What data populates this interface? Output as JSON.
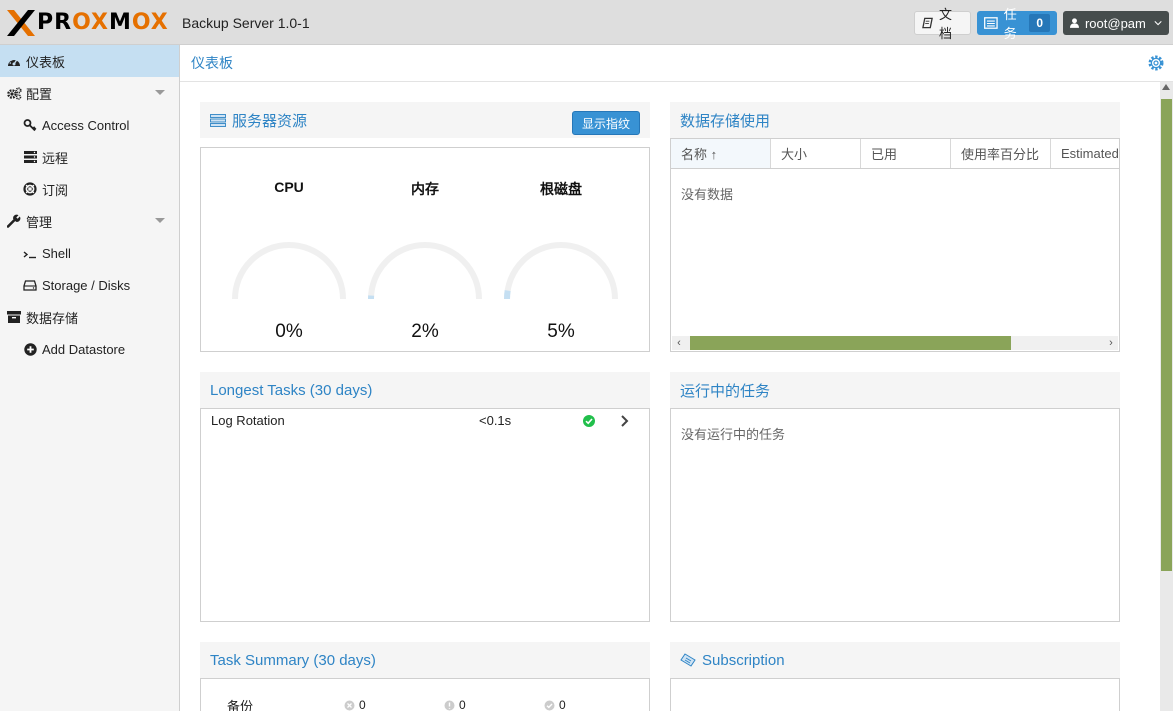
{
  "header": {
    "logo_text_1": "PR",
    "logo_text_2": "OX",
    "logo_text_3": "M",
    "logo_text_4": "OX",
    "product": "Backup Server 1.0-1",
    "docs_label": "文档",
    "tasks_label": "任务",
    "tasks_count": "0",
    "user_label": "root@pam"
  },
  "sidebar": {
    "items": [
      {
        "label": "仪表板",
        "icon": "dashboard-icon",
        "active": true
      },
      {
        "label": "配置",
        "icon": "cogs-icon"
      },
      {
        "label": "Access Control",
        "icon": "key-icon"
      },
      {
        "label": "远程",
        "icon": "server-icon"
      },
      {
        "label": "订阅",
        "icon": "support-icon"
      },
      {
        "label": "管理",
        "icon": "wrench-icon"
      },
      {
        "label": "Shell",
        "icon": "terminal-icon"
      },
      {
        "label": "Storage / Disks",
        "icon": "hdd-icon"
      },
      {
        "label": "数据存储",
        "icon": "archive-icon"
      },
      {
        "label": "Add Datastore",
        "icon": "plus-circle-icon"
      }
    ]
  },
  "content": {
    "title": "仪表板"
  },
  "server_resources": {
    "title": "服务器资源",
    "fingerprint_button": "显示指纹",
    "gauges": [
      {
        "label": "CPU",
        "value_text": "0%",
        "fraction": 0.0
      },
      {
        "label": "内存",
        "value_text": "2%",
        "fraction": 0.02
      },
      {
        "label": "根磁盘",
        "value_text": "5%",
        "fraction": 0.05
      }
    ]
  },
  "datastore_usage": {
    "title": "数据存储使用",
    "columns": [
      "名称 ↑",
      "大小",
      "已用",
      "使用率百分比",
      "Estimated"
    ],
    "empty_text": "没有数据"
  },
  "longest_tasks": {
    "title": "Longest Tasks (30 days)",
    "rows": [
      {
        "name": "Log Rotation",
        "duration": "<0.1s",
        "status": "ok"
      }
    ]
  },
  "running_tasks": {
    "title": "运行中的任务",
    "empty_text": "没有运行中的任务"
  },
  "task_summary": {
    "title": "Task Summary (30 days)",
    "row_label": "备份",
    "counts": [
      "0",
      "0",
      "0"
    ]
  },
  "subscription": {
    "title": "Subscription"
  },
  "colors": {
    "accent": "#3892d4",
    "title_blue": "#2e84c5",
    "gauge_track": "#f0f0f0",
    "gauge_fill": "#c5dff2",
    "scroll_green": "#8aa459",
    "ok_green": "#21bf4b"
  }
}
